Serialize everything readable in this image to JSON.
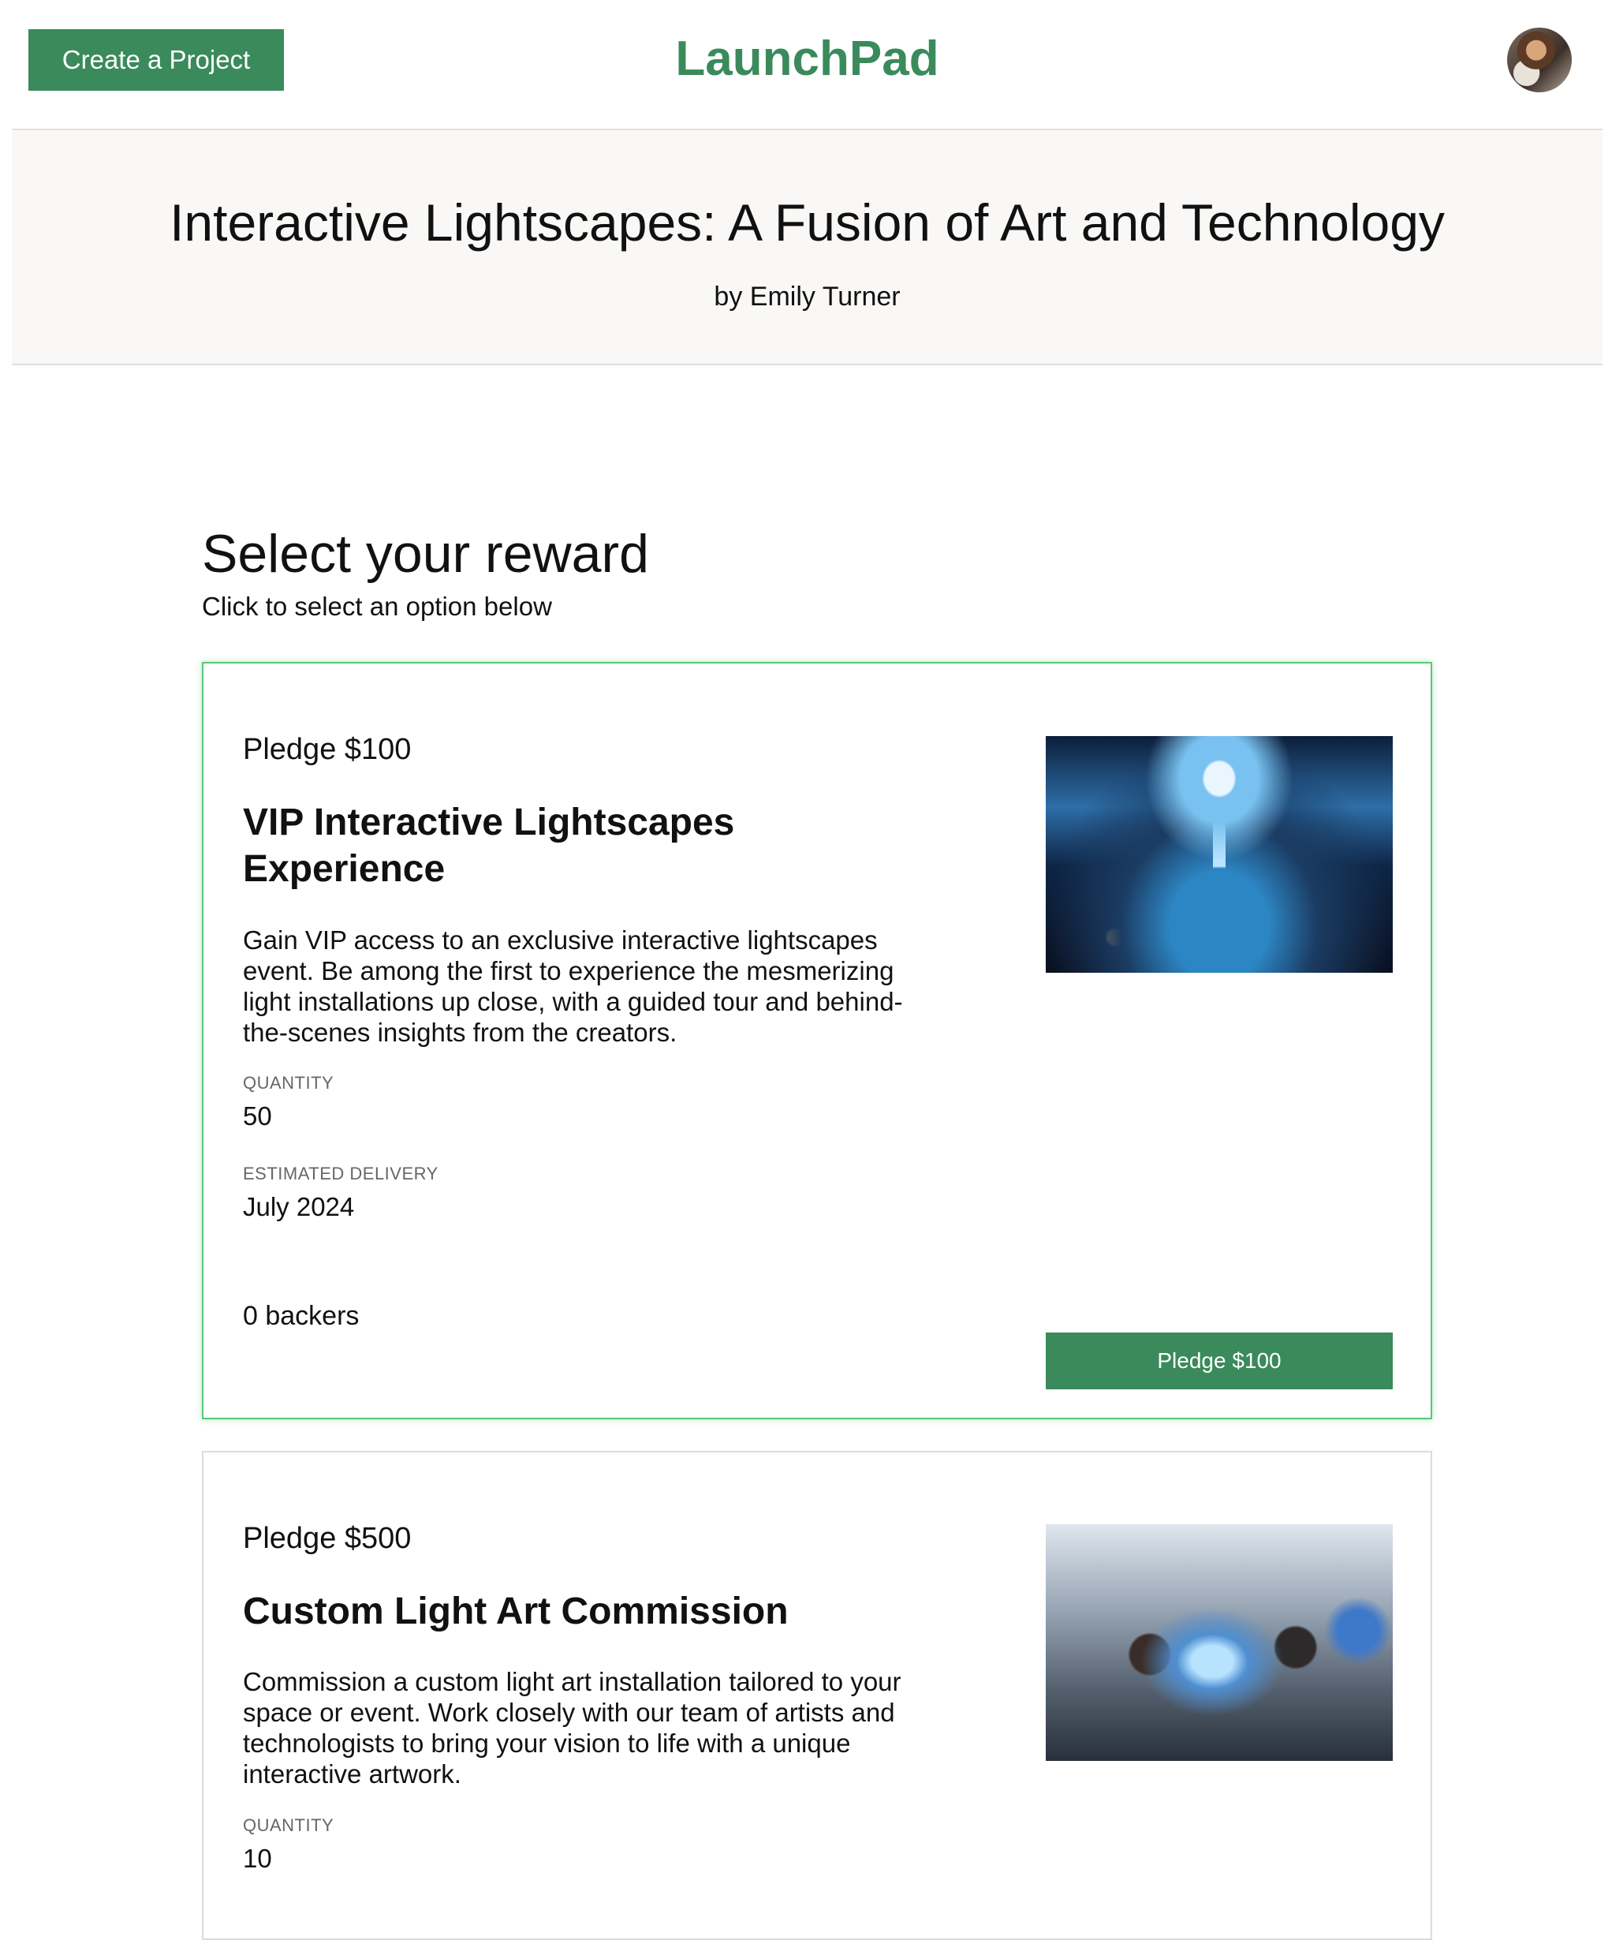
{
  "header": {
    "create_button": "Create a Project",
    "brand": "LaunchPad",
    "avatar_icon": "user-avatar"
  },
  "hero": {
    "title": "Interactive Lightscapes: A Fusion of Art and Technology",
    "author": "by Emily Turner"
  },
  "rewards_section": {
    "title": "Select your reward",
    "subtitle": "Click to select an option below"
  },
  "rewards": [
    {
      "pledge": "Pledge $100",
      "title": "VIP Interactive Lightscapes Experience",
      "description": "Gain VIP access to an exclusive interactive lightscapes event. Be among the first to experience the mesmerizing light installations up close, with a guided tour and behind-the-scenes insights from the creators.",
      "quantity_label": "QUANTITY",
      "quantity": "50",
      "delivery_label": "ESTIMATED DELIVERY",
      "delivery": "July 2024",
      "backers": "0 backers",
      "button": "Pledge $100",
      "selected": true
    },
    {
      "pledge": "Pledge $500",
      "title": "Custom Light Art Commission",
      "description": "Commission a custom light art installation tailored to your space or event. Work closely with our team of artists and technologists to bring your vision to life with a unique interactive artwork.",
      "quantity_label": "QUANTITY",
      "quantity": "10"
    }
  ],
  "colors": {
    "accent": "#3a8a5c",
    "selected_border": "#59c77a",
    "hero_bg": "#f9f8f6"
  }
}
